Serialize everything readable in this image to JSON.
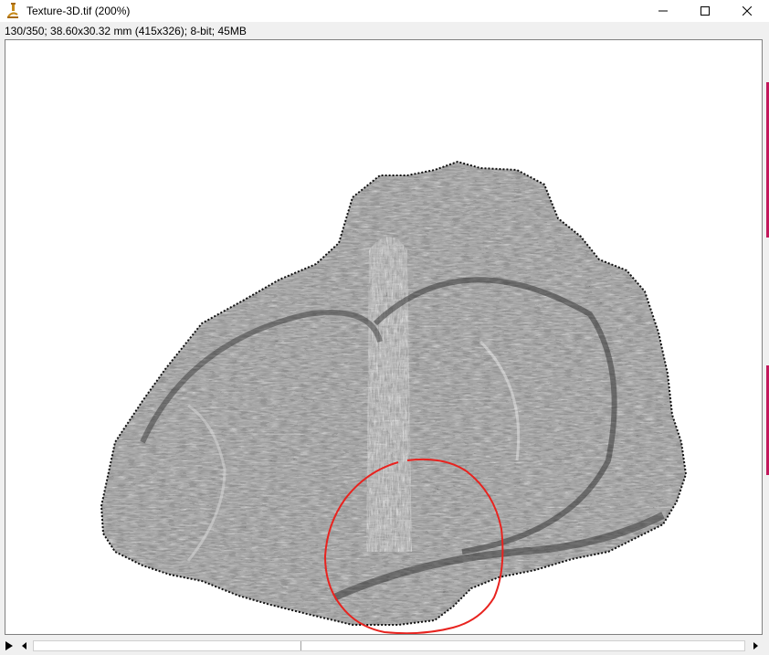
{
  "window": {
    "title": "Texture-3D.tif (200%)",
    "icon": "microscope-icon",
    "controls": {
      "minimize": "minimize-icon",
      "maximize": "maximize-icon",
      "close": "close-icon"
    }
  },
  "image_info": {
    "text": "130/350; 38.60x30.32 mm (415x326); 8-bit; 45MB"
  },
  "annotation": {
    "shape": "freehand-circle",
    "color": "#e8231f"
  },
  "scrollbar": {
    "play_icon": "play-icon",
    "left_icon": "scroll-left-arrow-icon",
    "right_icon": "scroll-right-arrow-icon"
  },
  "colors": {
    "texture_dark": "#1e1e1e",
    "texture_mid": "#8a8a8a",
    "background": "#ffffff"
  }
}
